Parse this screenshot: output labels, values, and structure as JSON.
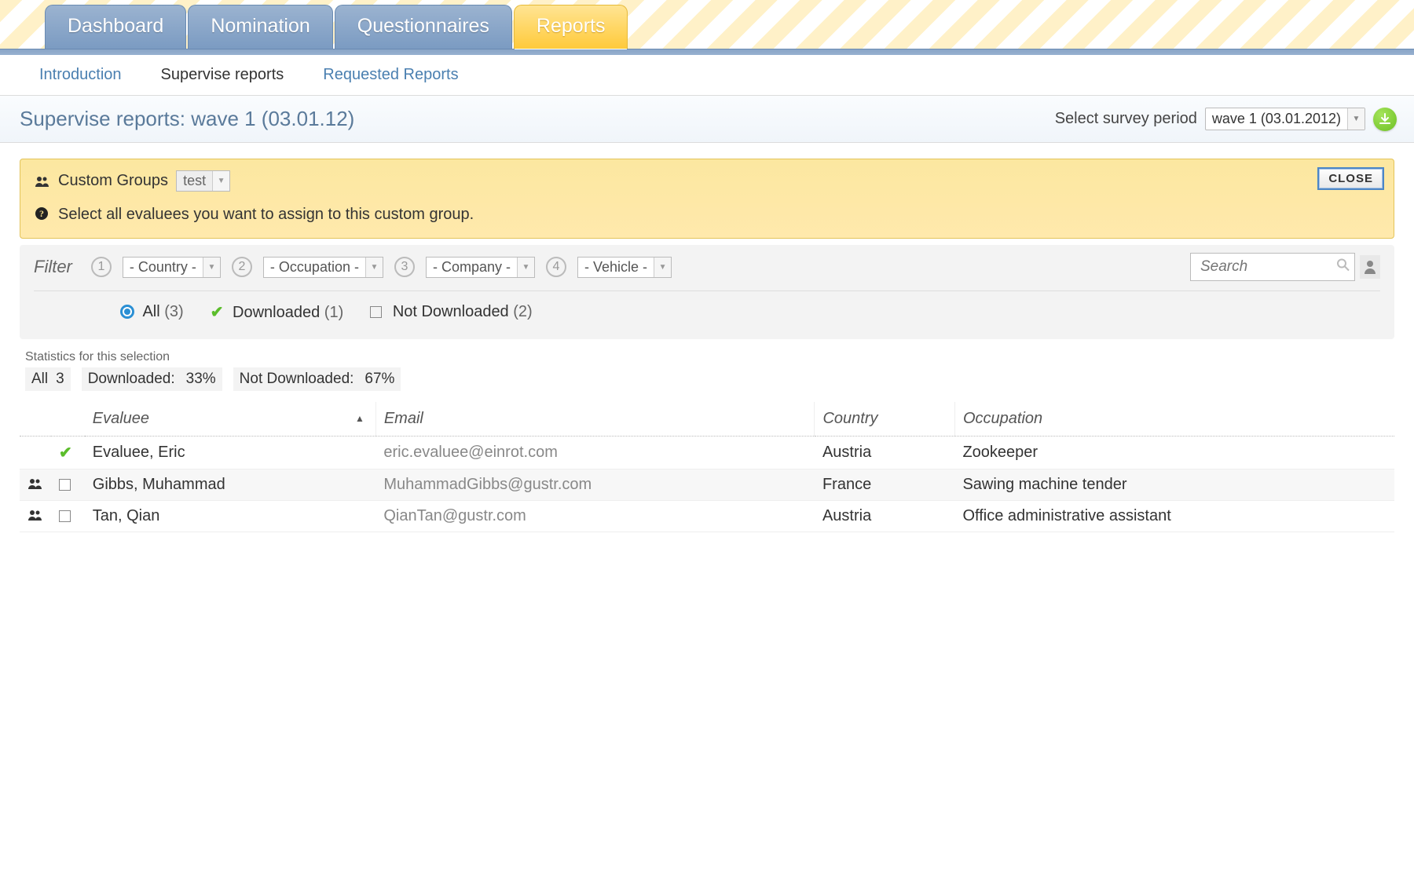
{
  "nav": {
    "tabs": [
      "Dashboard",
      "Nomination",
      "Questionnaires",
      "Reports"
    ],
    "active_index": 3
  },
  "subnav": {
    "items": [
      "Introduction",
      "Supervise reports",
      "Requested Reports"
    ],
    "active_index": 1
  },
  "title": "Supervise reports: wave 1 (03.01.12)",
  "survey_period": {
    "label": "Select survey period",
    "value": "wave 1 (03.01.2012)"
  },
  "group_box": {
    "heading": "Custom Groups",
    "selected": "test",
    "instruction": "Select all evaluees you want to assign to this custom group.",
    "close_label": "CLOSE"
  },
  "filter": {
    "label": "Filter",
    "options": [
      {
        "num": "1",
        "value": "- Country -"
      },
      {
        "num": "2",
        "value": "- Occupation -"
      },
      {
        "num": "3",
        "value": "- Company -"
      },
      {
        "num": "4",
        "value": "- Vehicle -"
      }
    ],
    "search_placeholder": "Search",
    "status": {
      "all": {
        "label": "All",
        "count": "(3)"
      },
      "downloaded": {
        "label": "Downloaded",
        "count": "(1)"
      },
      "not_downloaded": {
        "label": "Not Downloaded",
        "count": "(2)"
      }
    }
  },
  "stats": {
    "heading": "Statistics for this selection",
    "all": {
      "label": "All",
      "value": "3"
    },
    "downloaded": {
      "label": "Downloaded:",
      "pct": "33%"
    },
    "not_downloaded": {
      "label": "Not Downloaded:",
      "pct": "67%"
    }
  },
  "table": {
    "columns": {
      "evaluee": "Evaluee",
      "email": "Email",
      "country": "Country",
      "occupation": "Occupation"
    },
    "rows": [
      {
        "downloaded": true,
        "in_group": false,
        "evaluee": "Evaluee, Eric",
        "email": "eric.evaluee@einrot.com",
        "country": "Austria",
        "occupation": "Zookeeper"
      },
      {
        "downloaded": false,
        "in_group": true,
        "evaluee": "Gibbs, Muhammad",
        "email": "MuhammadGibbs@gustr.com",
        "country": "France",
        "occupation": "Sawing machine tender"
      },
      {
        "downloaded": false,
        "in_group": true,
        "evaluee": "Tan, Qian",
        "email": "QianTan@gustr.com",
        "country": "Austria",
        "occupation": "Office administrative assistant"
      }
    ]
  }
}
